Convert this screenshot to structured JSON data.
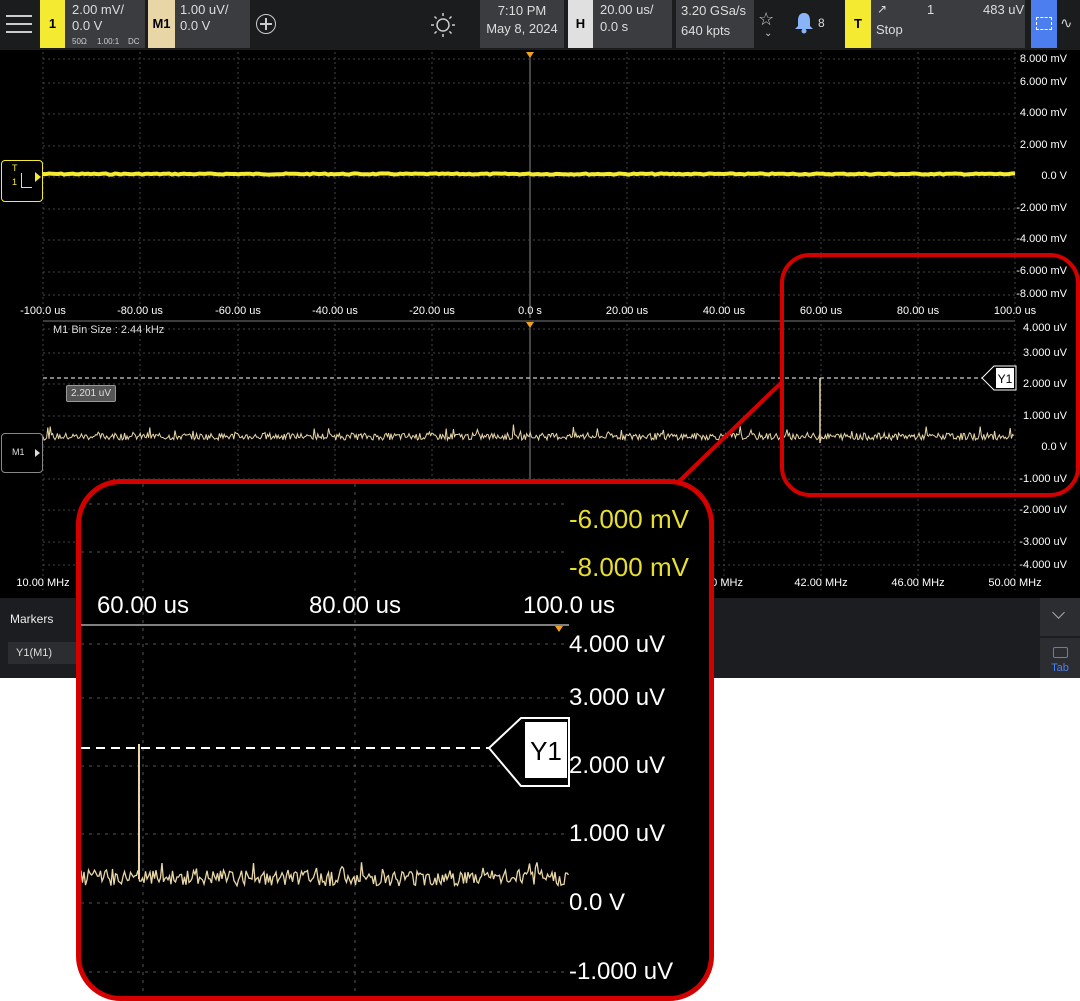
{
  "toolbar": {
    "ch1": {
      "badge": "1",
      "scale": "2.00 mV/",
      "offset": "0.0 V",
      "impedance": "50Ω",
      "probe": "1.00:1",
      "coupling": "DC"
    },
    "m1": {
      "badge": "M1",
      "scale": "1.00 uV/",
      "offset": "0.0 V"
    },
    "time": "7:10 PM",
    "date": "May 8, 2024",
    "horizontal": {
      "badge": "H",
      "scale": "20.00 us/",
      "delay": "0.0 s"
    },
    "acquisition": {
      "rate": "3.20 GSa/s",
      "points": "640 kpts"
    },
    "notifications": "8",
    "trigger": {
      "badge": "T",
      "source": "1",
      "level": "483 uV",
      "state": "Stop"
    }
  },
  "upper_y_labels": [
    "8.000 mV",
    "6.000 mV",
    "4.000 mV",
    "2.000 mV",
    "0.0 V",
    "-2.000 mV",
    "-4.000 mV",
    "-6.000 mV",
    "-8.000 mV"
  ],
  "time_labels": [
    "-100.0 us",
    "-80.00 us",
    "-60.00 us",
    "-40.00 us",
    "-20.00 us",
    "0.0 s",
    "20.00 us",
    "40.00 us",
    "60.00 us",
    "80.00 us",
    "100.0 us"
  ],
  "lower_y_labels": [
    "4.000 uV",
    "3.000 uV",
    "2.000 uV",
    "1.000 uV",
    "0.0 V",
    "-1.000 uV",
    "-2.000 uV",
    "-3.000 uV",
    "-4.000 uV"
  ],
  "freq_labels": [
    "10.00 MHz",
    "00 MHz",
    "42.00 MHz",
    "46.00 MHz",
    "50.00 MHz"
  ],
  "bin_size": "M1 Bin Size : 2.44 kHz",
  "cursor_readout": "2.201 uV",
  "trigger_marker_label": "T",
  "ch1_marker_label": "1",
  "m1_marker_label": "M1",
  "y1_label": "Y1",
  "markers_panel": {
    "title": "Markers",
    "item": "Y1(M1)",
    "tab_label": "Tab"
  },
  "zoom": {
    "upper_labels": [
      "-6.000 mV",
      "-8.000 mV"
    ],
    "time_labels": [
      "60.00 us",
      "80.00 us",
      "100.0 us"
    ],
    "y_labels": [
      "4.000 uV",
      "3.000 uV",
      "2.000 uV",
      "1.000 uV",
      "0.0 V",
      "-1.000 uV"
    ],
    "y1_label": "Y1"
  },
  "colors": {
    "ch1": "#f4ea32",
    "m1": "#e8d6a6",
    "highlight": "#d40000",
    "grid": "#555555"
  }
}
